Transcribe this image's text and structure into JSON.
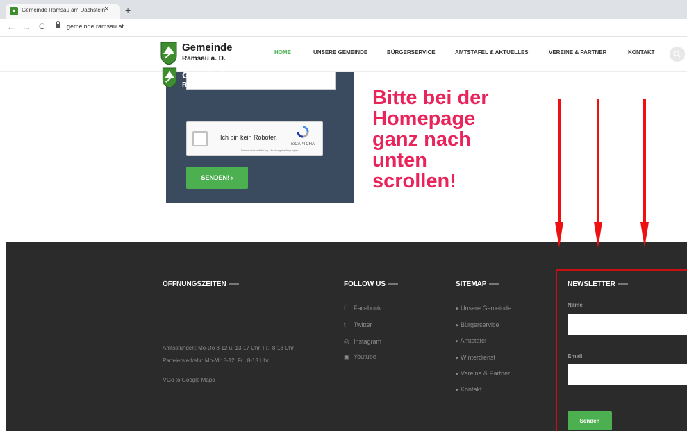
{
  "browser": {
    "tab_title": "Gemeinde Ramsau am Dachstein",
    "tab_close": "×",
    "new_tab": "+",
    "url": "gemeinde.ramsau.at",
    "back": "←",
    "forward": "→",
    "reload": "C"
  },
  "header": {
    "logo_line1": "Gemeinde",
    "logo_line2": "Ramsau a. D.",
    "nav": [
      "HOME",
      "UNSERE GEMEINDE",
      "BÜRGERSERVICE",
      "AMTSTAFEL & AKTUELLES",
      "VEREINE & PARTNER",
      "KONTAKT"
    ],
    "active_nav": "HOME",
    "search_icon": "search-icon"
  },
  "form": {
    "recaptcha_label": "Ich bin kein Roboter.",
    "recaptcha_brand": "reCAPTCHA",
    "recaptcha_links": "Datenschutzerklärung - Nutzungsbedingungen",
    "submit_label": "SENDEN!  ›"
  },
  "annotation": {
    "lines": [
      "Bitte bei der",
      "Homepage",
      "ganz nach",
      "unten",
      "scrollen!"
    ],
    "color": "#e8245a",
    "arrow_color": "#ee1111"
  },
  "footer": {
    "hours_heading": "ÖFFNUNGSZEITEN",
    "logo_line1": "Gemeinde",
    "logo_line2": "Ramsau a. D.",
    "hours_line1": "Amtsstunden: Mo-Do 8-12 u. 13-17 Uhr, Fr.: 8-13 Uhr",
    "hours_line2": "Parteienverkehr: Mo-Mi: 8-12, Fr.: 8-13 Uhr",
    "maps_link": "Go to Google Maps",
    "follow_heading": "FOLLOW US",
    "follow": [
      {
        "icon": "f",
        "label": "Facebook"
      },
      {
        "icon": "t",
        "label": "Twitter"
      },
      {
        "icon": "◎",
        "label": "Instagram"
      },
      {
        "icon": "▣",
        "label": "Youtube"
      }
    ],
    "sitemap_heading": "SITEMAP",
    "sitemap": [
      "Unsere Gemeinde",
      "Bürgerservice",
      "Amtstafel",
      "Winterdienst",
      "Vereine & Partner",
      "Kontakt"
    ],
    "newsletter_heading": "NEWSLETTER",
    "name_label": "Name",
    "email_label": "Email",
    "submit_label": "Senden"
  },
  "colors": {
    "accent_green": "#4cb050",
    "footer_bg": "#2b2b2b",
    "form_bg": "#3a4a5f",
    "highlight_red": "#c81010"
  }
}
